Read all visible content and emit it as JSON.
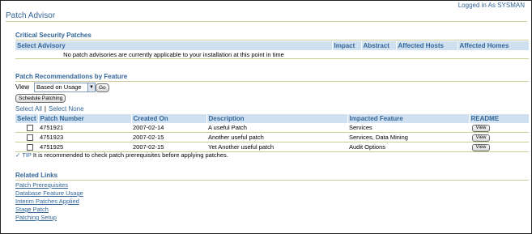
{
  "header": {
    "logged_in": "Logged in As SYSMAN",
    "title": "Patch Advisor"
  },
  "critical": {
    "title": "Critical Security Patches",
    "columns": [
      "Select Advisory",
      "Impact",
      "Abstract",
      "Affected Hosts",
      "Affected Homes"
    ],
    "empty_message": "No patch advisories are currently applicable to your installation at this point in time"
  },
  "recommendations": {
    "title": "Patch Recommendations by Feature",
    "view_label": "View",
    "view_value": "Based on Usage",
    "go_label": "Go",
    "schedule_label": "Schedule Patching",
    "select_all": "Select All",
    "select_none": "Select None",
    "columns": [
      "Select",
      "Patch Number",
      "Created On",
      "Description",
      "Impacted Feature",
      "README"
    ],
    "rows": [
      {
        "patch": "4751921",
        "created": "2007-02-14",
        "description": "A useful Patch",
        "feature": "Services",
        "readme": "View"
      },
      {
        "patch": "4751923",
        "created": "2007-02-15",
        "description": "Another useful patch",
        "feature": "Services, Data Mining",
        "readme": "View"
      },
      {
        "patch": "4751925",
        "created": "2007-02-15",
        "description": "Yet Another useful patch",
        "feature": "Audit Options",
        "readme": "View"
      }
    ],
    "tip_label": "TIP",
    "tip_text": "It is recommended to check patch prerequisites before applying patches."
  },
  "related": {
    "title": "Related Links",
    "links": [
      "Patch Prerequisites",
      "Database Feature Usage",
      "Interim Patches Applied",
      "Stage Patch",
      "Patching Setup"
    ]
  },
  "colors": {
    "accent": "#336699",
    "header_bg": "#cfe0f1",
    "rule": "#cccc99"
  }
}
